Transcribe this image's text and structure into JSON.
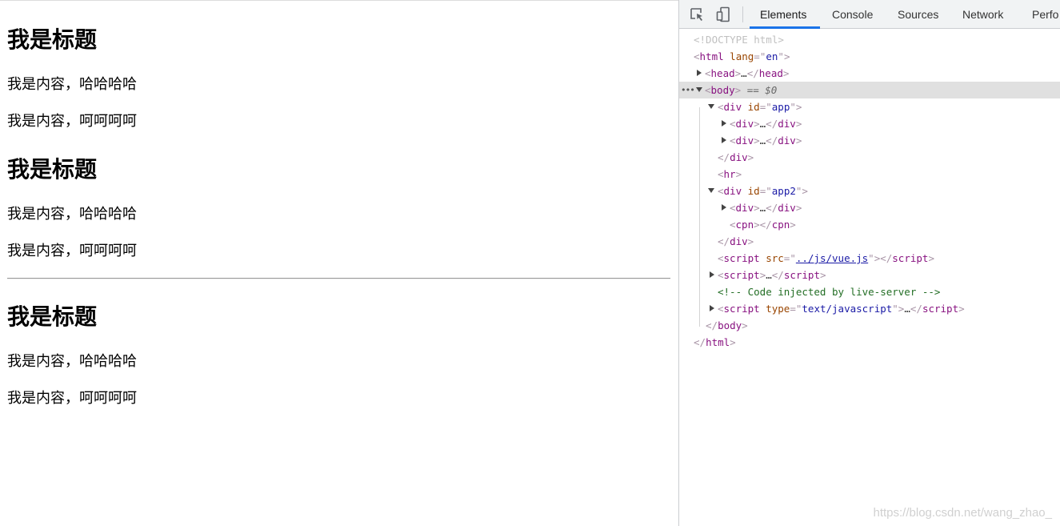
{
  "page": {
    "sections": [
      {
        "heading": "我是标题",
        "p1": "我是内容，哈哈哈哈",
        "p2": "我是内容，呵呵呵呵"
      },
      {
        "heading": "我是标题",
        "p1": "我是内容，哈哈哈哈",
        "p2": "我是内容，呵呵呵呵"
      },
      {
        "heading": "我是标题",
        "p1": "我是内容，哈哈哈哈",
        "p2": "我是内容，呵呵呵呵"
      }
    ]
  },
  "devtools": {
    "toolbar_icons": [
      "inspect-element-icon",
      "device-toolbar-icon"
    ],
    "tabs": [
      {
        "label": "Elements",
        "active": true
      },
      {
        "label": "Console"
      },
      {
        "label": "Sources"
      },
      {
        "label": "Network"
      },
      {
        "label": "Perfo"
      }
    ],
    "accent_color": "#1a73e8",
    "tree": {
      "doctype": "<!DOCTYPE html>",
      "html_tag": "html",
      "lang_attr": "lang",
      "lang_val": "en",
      "head_tag": "head",
      "body_tag": "body",
      "body_suffix": "== $0",
      "div_tag": "div",
      "id_attr": "id",
      "app_id": "app",
      "hr_tag": "hr",
      "app2_id": "app2",
      "cpn_tag": "cpn",
      "script_tag": "script",
      "src_attr": "src",
      "src_val": "../js/vue.js",
      "comment": "<!-- Code injected by live-server -->",
      "type_attr": "type",
      "type_val": "text/javascript",
      "ellipsis": "…",
      "dots": "•••"
    }
  },
  "watermark": "https://blog.csdn.net/wang_zhao_"
}
